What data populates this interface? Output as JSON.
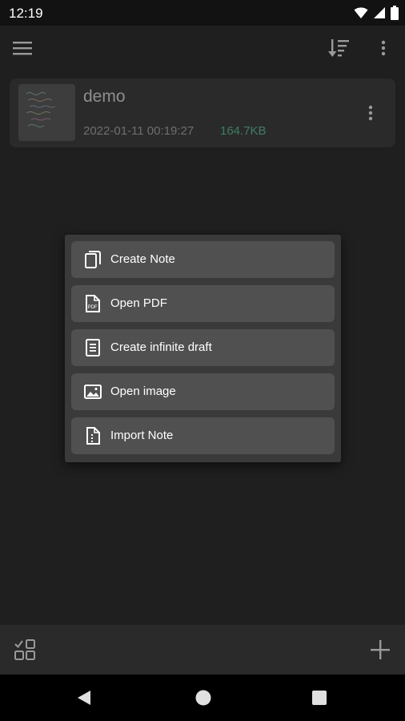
{
  "status": {
    "time": "12:19",
    "icons": [
      "wifi-icon",
      "signal-icon",
      "battery-icon"
    ]
  },
  "appbar": {
    "menu_icon": "hamburger-menu-icon",
    "sort_icon": "sort-icon",
    "overflow_icon": "more-vert-icon"
  },
  "note": {
    "title": "demo",
    "date": "2022-01-11 00:19:27",
    "size": "164.7KB"
  },
  "menu": {
    "items": [
      {
        "label": "Create Note",
        "icon": "copy-pages-icon"
      },
      {
        "label": "Open PDF",
        "icon": "pdf-file-icon"
      },
      {
        "label": "Create infinite draft",
        "icon": "document-lines-icon"
      },
      {
        "label": "Open image",
        "icon": "image-icon"
      },
      {
        "label": "Import Note",
        "icon": "import-file-icon"
      }
    ]
  },
  "bottom": {
    "select_icon": "checklist-grid-icon",
    "add_icon": "plus-icon"
  },
  "nav": {
    "back_icon": "back-triangle-icon",
    "home_icon": "home-circle-icon",
    "recents_icon": "recents-square-icon"
  },
  "colors": {
    "background": "#1f1f1f",
    "card": "#2a2a2a",
    "menu": "#3a3a3a",
    "menu_item": "#505050",
    "size_text": "#3f7d63"
  }
}
